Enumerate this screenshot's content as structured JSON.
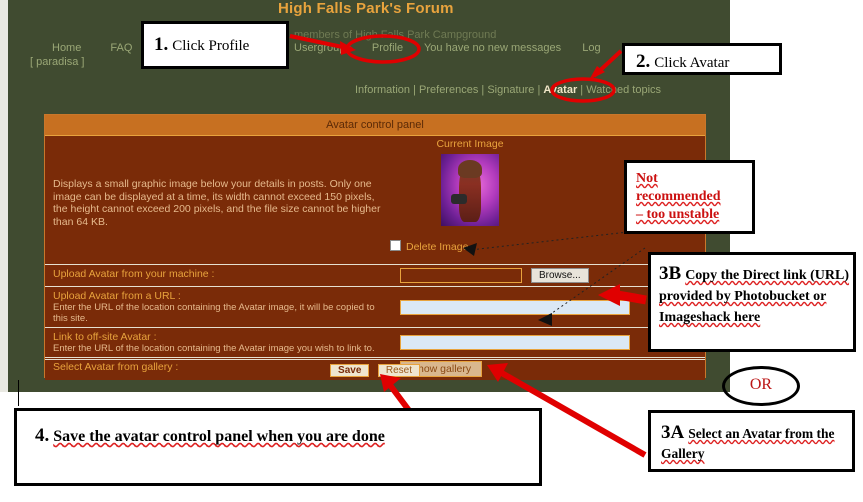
{
  "forum": {
    "title": "High Falls Park's Forum",
    "subtitle": "members of High Falls Park Campground",
    "left_nav": [
      "Home",
      "FAQ"
    ],
    "user_tag": "[ paradisa ]",
    "top_nav": [
      "Usergroups",
      "Profile",
      "You have no new messages",
      "Log"
    ],
    "profile_tabs": [
      "Information",
      "Preferences",
      "Signature",
      "Avatar",
      "Watched topics"
    ],
    "active_tab": "Avatar",
    "tab_separator": "|"
  },
  "panel": {
    "title": "Avatar control panel",
    "description": "Displays a small graphic image below your details in posts. Only one image can be displayed at a time, its width cannot exceed 150 pixels, the height cannot exceed 200 pixels, and the file size cannot be higher than 64 KB.",
    "current_image_label": "Current Image",
    "delete_image_label": "Delete Image",
    "delete_image_checked": false,
    "rows": [
      {
        "label": "Upload Avatar from your machine :",
        "sub": "",
        "field_type": "file",
        "value": "",
        "button": "Browse..."
      },
      {
        "label": "Upload Avatar from a URL :",
        "sub": "Enter the URL of the location containing the Avatar image, it will be copied to this site.",
        "field_type": "text",
        "value": "",
        "button": ""
      },
      {
        "label": "Link to off-site Avatar :",
        "sub": "Enter the URL of the location containing the Avatar image you wish to link to.",
        "field_type": "text",
        "value": "",
        "button": ""
      },
      {
        "label": "Select Avatar from gallery :",
        "sub": "",
        "field_type": "button",
        "value": "",
        "button": "Show gallery"
      }
    ],
    "save_label": "Save",
    "reset_label": "Reset"
  },
  "annotations": {
    "step1": {
      "num": "1.",
      "text": "Click Profile"
    },
    "step2": {
      "num": "2.",
      "text": "Click Avatar"
    },
    "warning": {
      "line1": "Not",
      "line2": "recommended",
      "line3": "– too unstable"
    },
    "step3b": {
      "num": "3B",
      "text": "Copy the Direct link (URL) provided by Photobucket or Imageshack here"
    },
    "step3a": {
      "num": "3A",
      "text": "Select an Avatar from the Gallery"
    },
    "step4": {
      "num": "4.",
      "text": "Save the avatar control panel when you are done"
    },
    "or_label": "OR"
  },
  "colors": {
    "forum_bg": "#404b30",
    "panel_bg": "#7a2b08",
    "panel_header": "#c77021",
    "accent_orange": "#e8a33d",
    "annotation_red": "#cc1111",
    "link_green": "#9aa776"
  }
}
